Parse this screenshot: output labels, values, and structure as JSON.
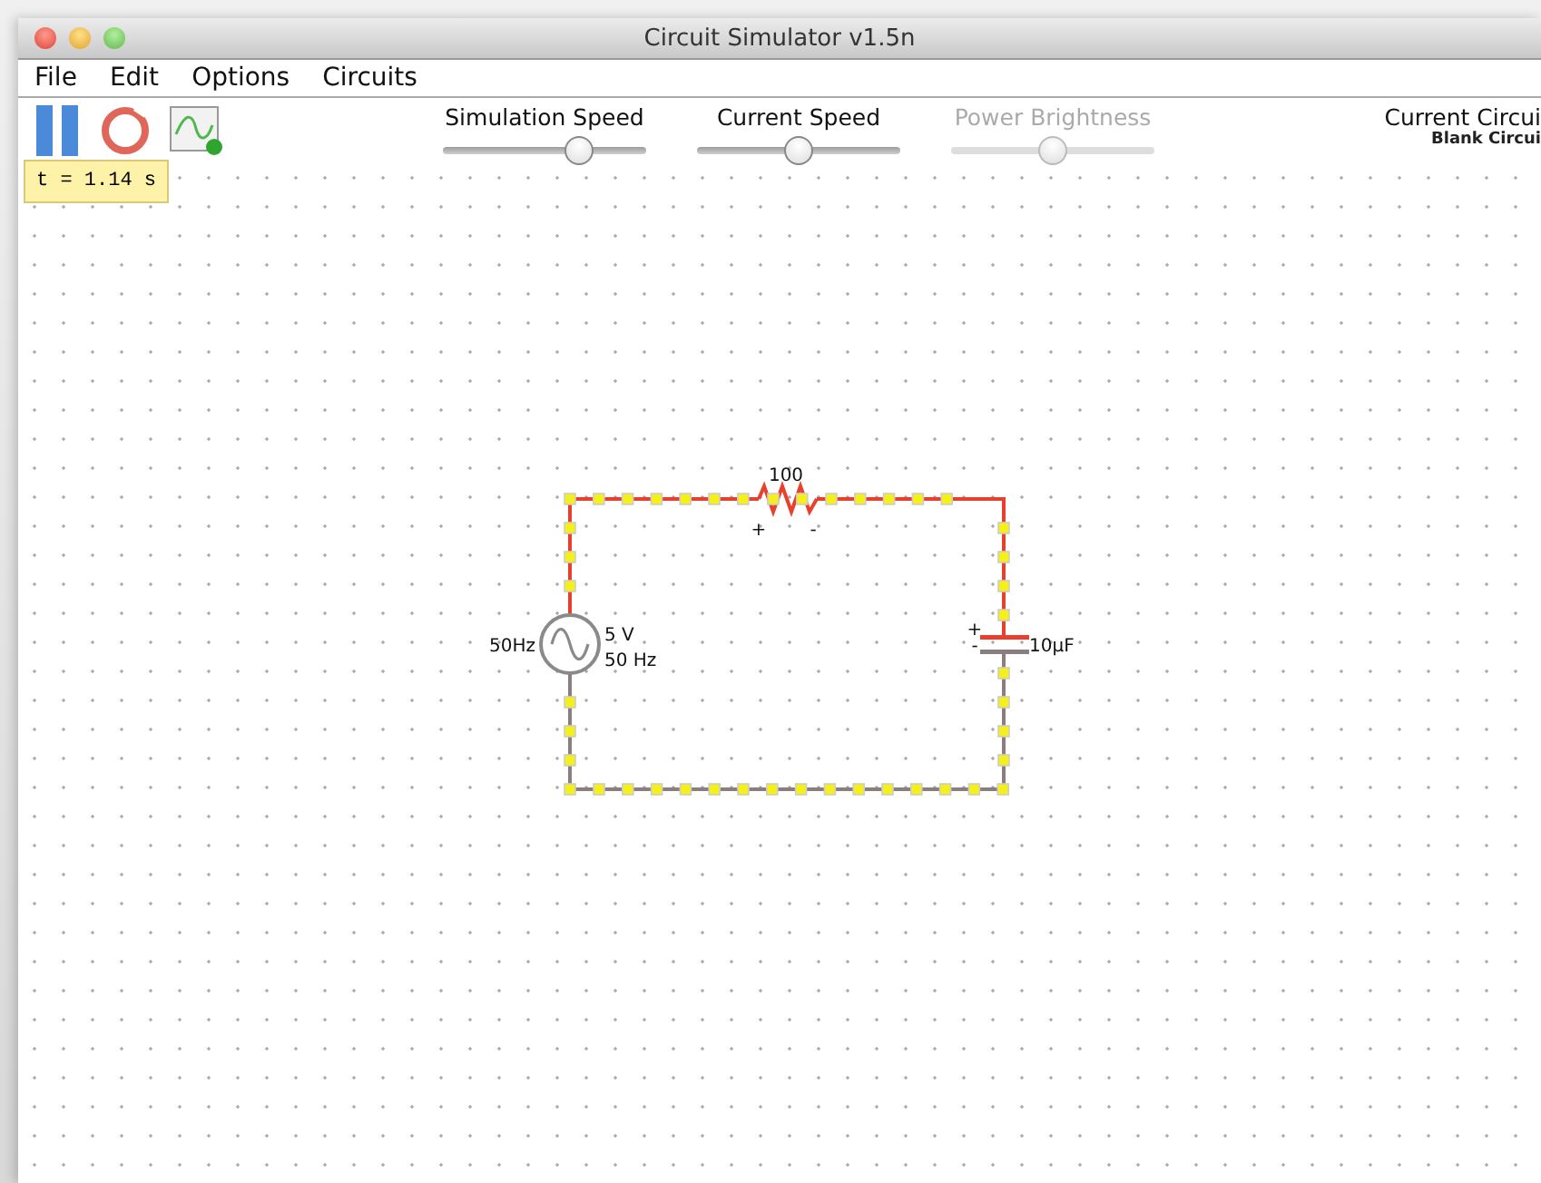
{
  "window": {
    "title": "Circuit Simulator v1.5n"
  },
  "menu": [
    "File",
    "Edit",
    "Options",
    "Circuits"
  ],
  "toolbar": {
    "paused": true,
    "sliders": [
      {
        "label": "Simulation Speed",
        "level": 0.67,
        "disabled": false
      },
      {
        "label": "Current Speed",
        "level": 0.5,
        "disabled": false
      },
      {
        "label": "Power Brightness",
        "level": 0.5,
        "disabled": true
      }
    ],
    "circuit_title": "Current Circui",
    "circuit_name": "Blank Circui"
  },
  "time": "t = 1.14 s",
  "circuit": {
    "resistor": {
      "value": "100",
      "plus": "+",
      "minus": "-"
    },
    "source": {
      "left_label": "50Hz",
      "voltage": "5 V",
      "frequency": "50 Hz"
    },
    "capacitor": {
      "plus": "+",
      "minus": "-",
      "value": "10µF"
    }
  }
}
